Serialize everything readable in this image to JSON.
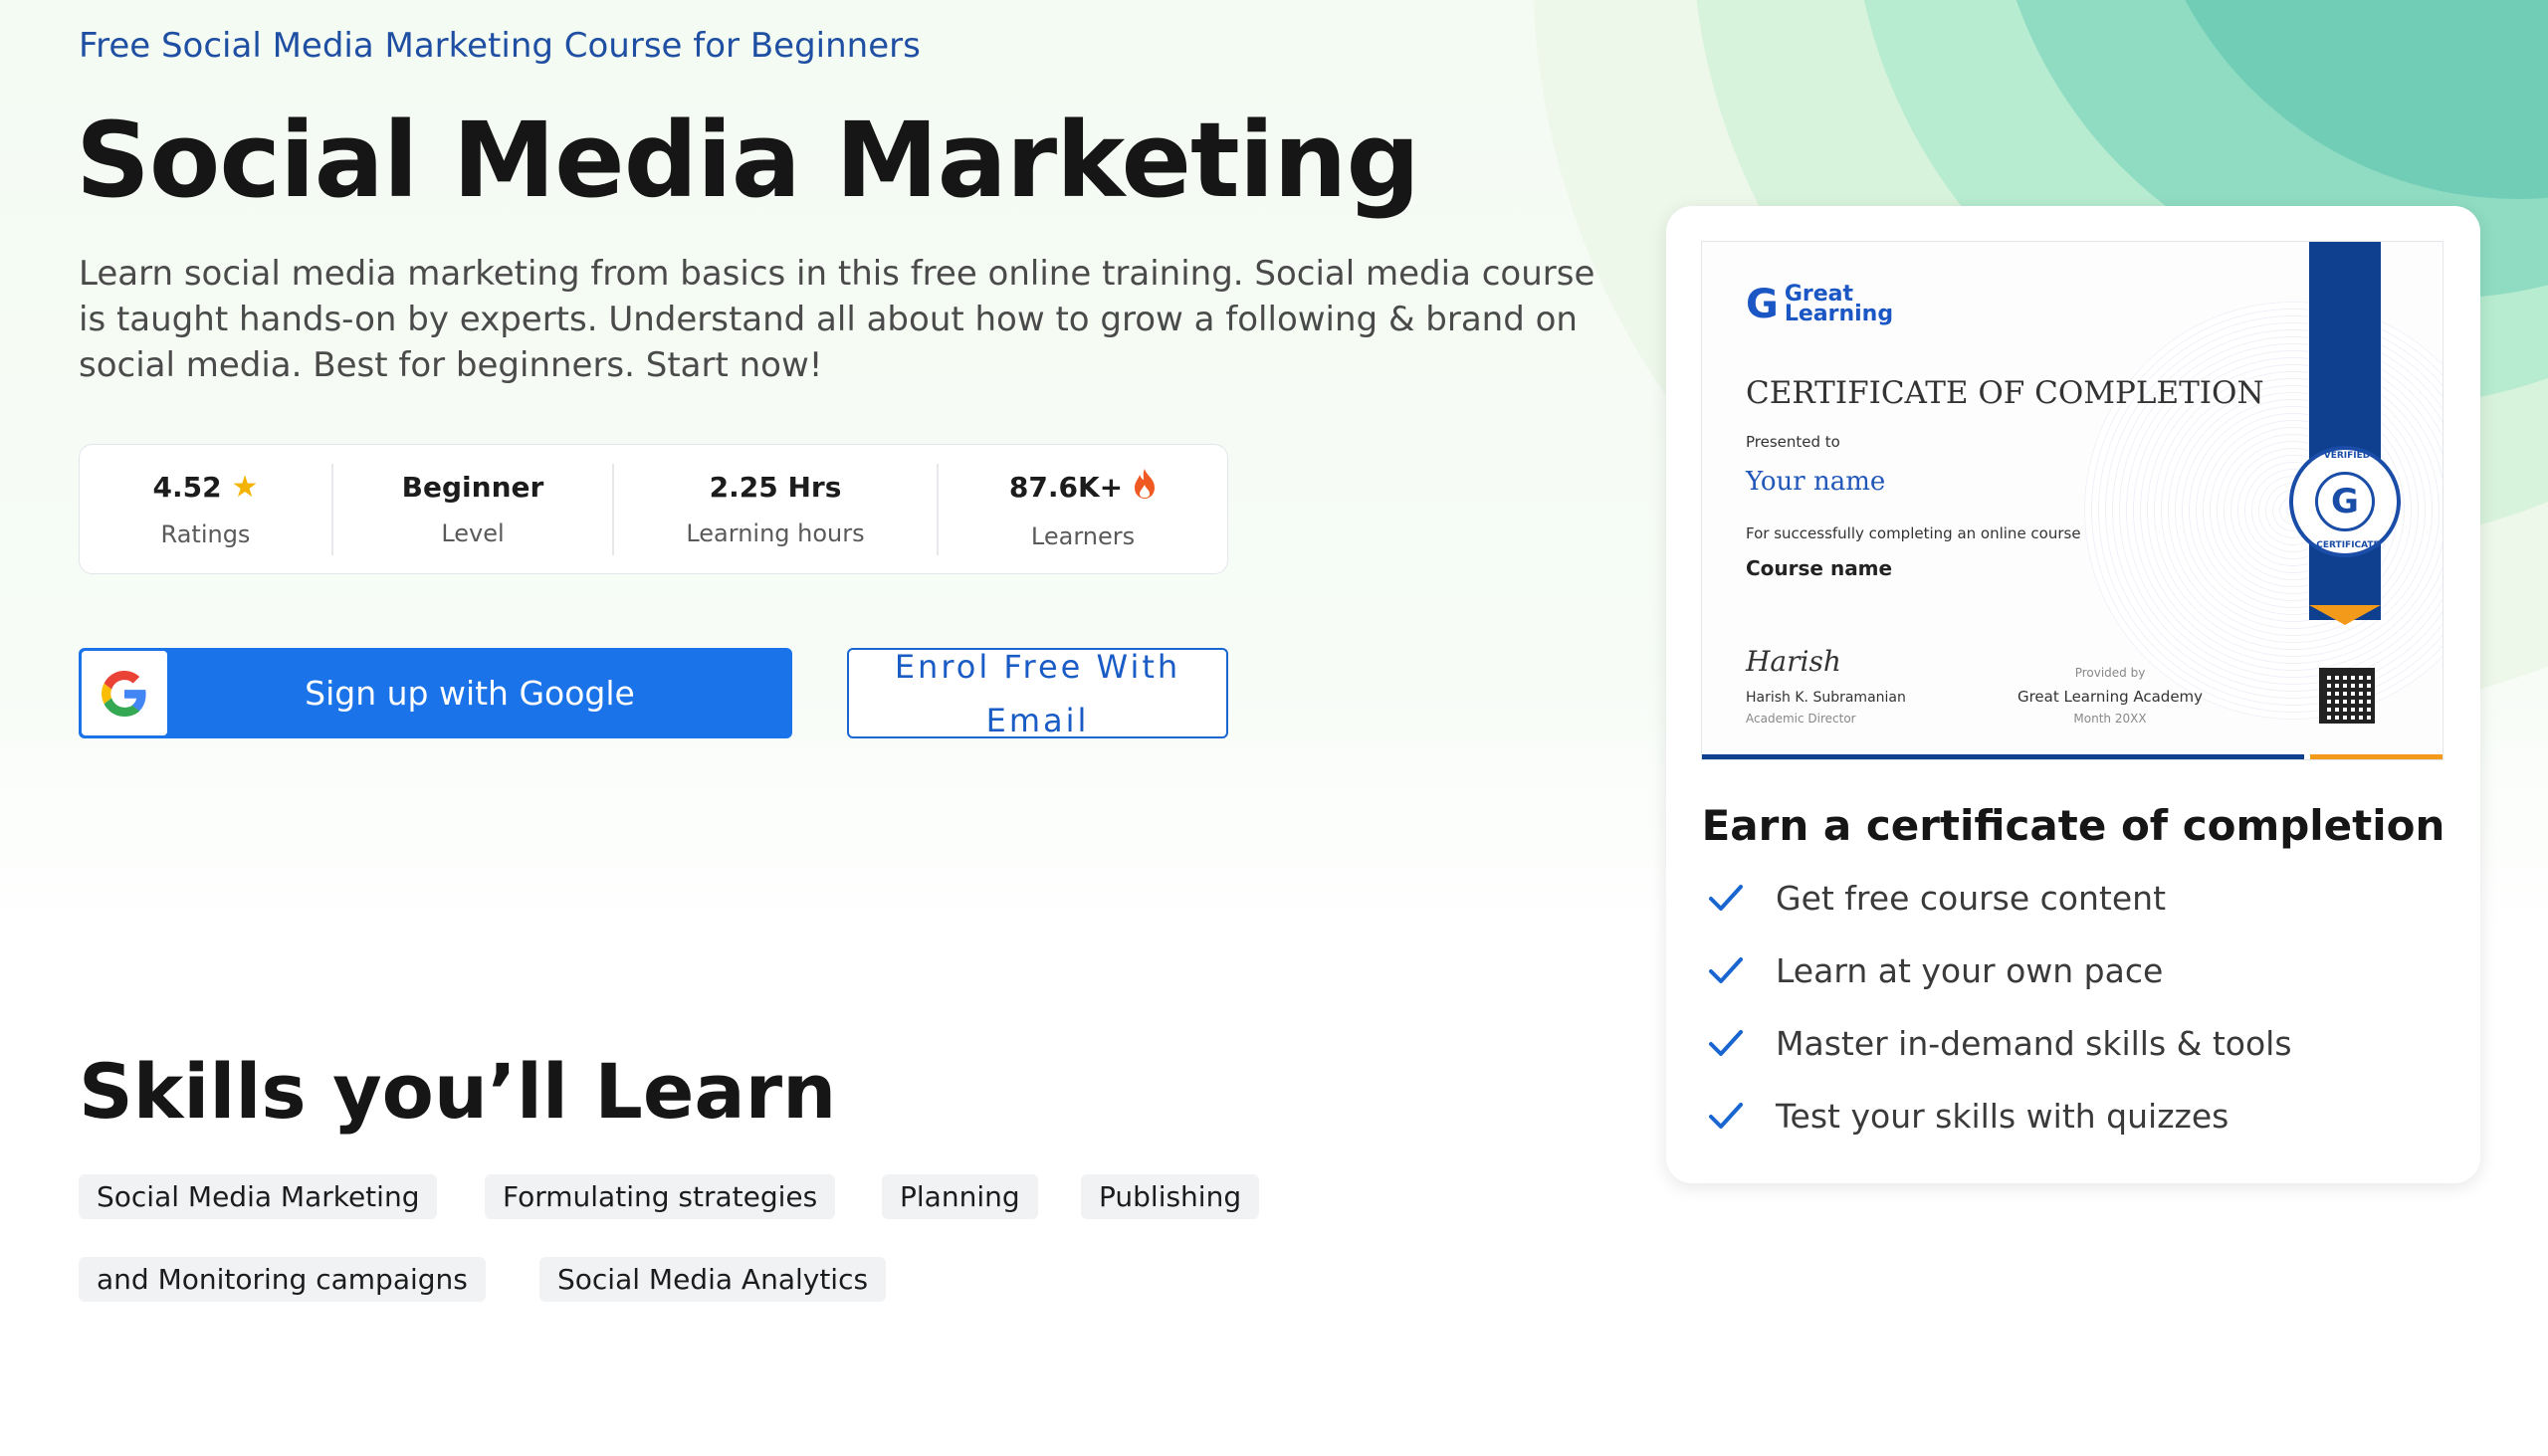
{
  "breadcrumb": "Free Social Media Marketing Course for Beginners",
  "title": "Social Media Marketing",
  "description": "Learn social media marketing from basics in this free online training. Social media course is taught hands-on by experts. Understand all about how to grow a following & brand on social media. Best for beginners. Start now!",
  "stats": [
    {
      "value": "4.52",
      "label": "Ratings",
      "icon": "star-icon"
    },
    {
      "value": "Beginner",
      "label": "Level"
    },
    {
      "value": "2.25 Hrs",
      "label": "Learning hours"
    },
    {
      "value": "87.6K+",
      "label": "Learners",
      "icon": "fire-icon"
    }
  ],
  "buttons": {
    "google": "Sign up with Google",
    "email": "Enrol Free With Email"
  },
  "skills": {
    "title": "Skills you’ll Learn",
    "items": [
      "Social Media Marketing",
      "Formulating strategies",
      "Planning",
      "Publishing",
      "and Monitoring campaigns",
      "Social Media Analytics"
    ]
  },
  "certificate": {
    "logo_line1": "Great",
    "logo_line2": "Learning",
    "heading": "CERTIFICATE OF COMPLETION",
    "presented_to": "Presented to",
    "name": "Your name",
    "completing": "For successfully completing an online course",
    "course": "Course name",
    "signature": "Harish",
    "signer": "Harish K. Subramanian",
    "signer_title": "Academic Director",
    "provided_by": "Provided by",
    "provider": "Great Learning Academy",
    "date": "Month 20XX",
    "seal_top": "VERIFIED",
    "seal_bottom": "CERTIFICATE"
  },
  "earn": {
    "title": "Earn a certificate of completion",
    "benefits": [
      "Get free course content",
      "Learn at your own pace",
      "Master in-demand skills & tools",
      "Test your skills with quizzes"
    ]
  },
  "colors": {
    "primary_blue": "#1a73e8",
    "accent_orange": "#f39a1a",
    "star_yellow": "#f5b301",
    "fire_orange": "#f05a22"
  }
}
